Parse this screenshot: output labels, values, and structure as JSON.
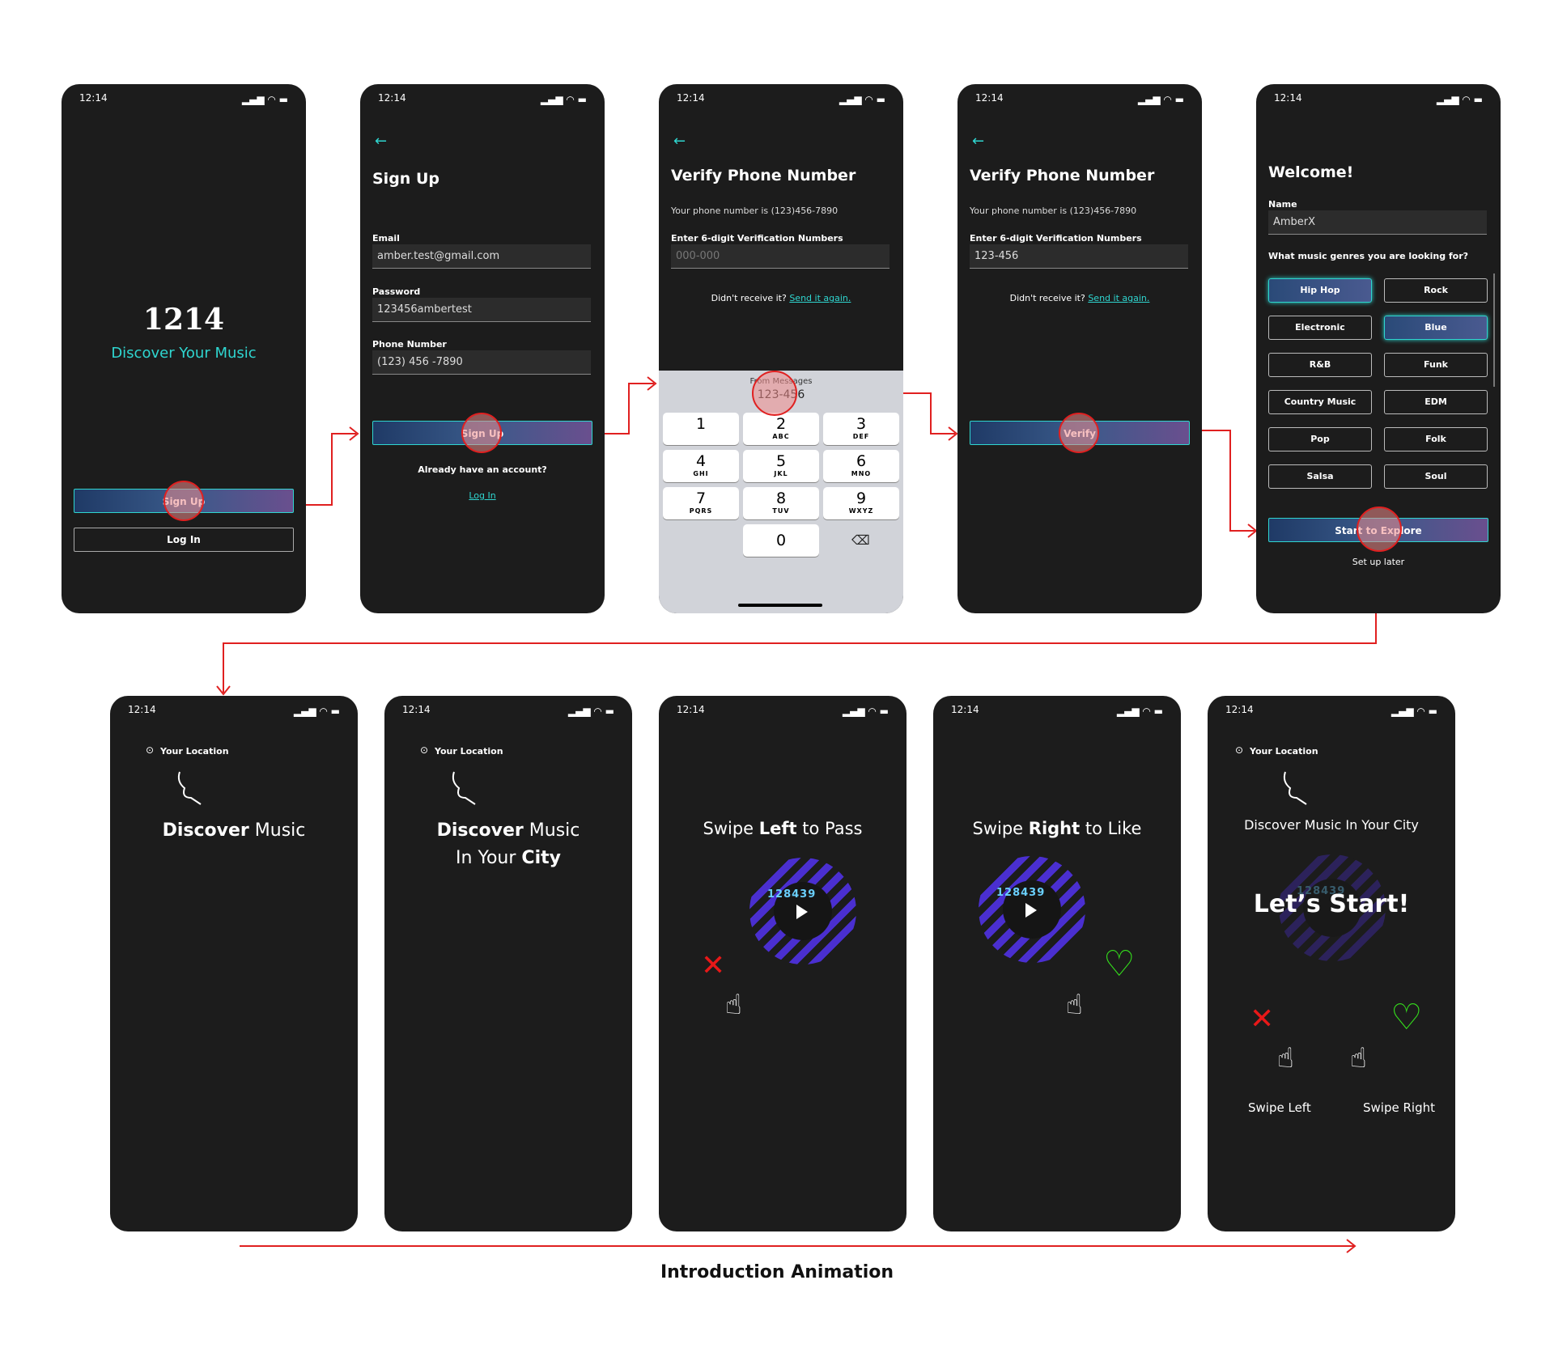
{
  "status_time": "12:14",
  "screen1": {
    "logo": "1214",
    "tagline": "Discover Your Music",
    "signup_label": "Sign Up",
    "login_label": "Log In"
  },
  "screen2": {
    "title": "Sign Up",
    "email_label": "Email",
    "email_value": "amber.test@gmail.com",
    "password_label": "Password",
    "password_value": "123456ambertest",
    "phone_label": "Phone Number",
    "phone_value": "(123) 456 -7890",
    "signup_label": "Sign Up",
    "have_account": "Already have an account?",
    "login_link": "Log In"
  },
  "screen3": {
    "title": "Verify Phone Number",
    "phone_text": "Your phone number is (123)456-7890",
    "code_label": "Enter 6-digit Verification Numbers",
    "code_placeholder": "000-000",
    "didnt_receive": "Didn't receive it?",
    "send_again": "Send it again.",
    "suggest_source": "From Messages",
    "suggest_code": "123-456",
    "keys": [
      {
        "d": "1",
        "l": ""
      },
      {
        "d": "2",
        "l": "ABC"
      },
      {
        "d": "3",
        "l": "DEF"
      },
      {
        "d": "4",
        "l": "GHI"
      },
      {
        "d": "5",
        "l": "JKL"
      },
      {
        "d": "6",
        "l": "MNO"
      },
      {
        "d": "7",
        "l": "PQRS"
      },
      {
        "d": "8",
        "l": "TUV"
      },
      {
        "d": "9",
        "l": "WXYZ"
      },
      {
        "d": "0",
        "l": ""
      }
    ]
  },
  "screen4": {
    "title": "Verify Phone Number",
    "phone_text": "Your phone number is (123)456-7890",
    "code_label": "Enter 6-digit Verification Numbers",
    "code_value": "123-456",
    "didnt_receive": "Didn't receive it?",
    "send_again": "Send it again.",
    "verify_label": "Verify"
  },
  "screen5": {
    "title": "Welcome!",
    "name_label": "Name",
    "name_value": "AmberX",
    "genres_question": "What music genres you are looking for?",
    "genres": [
      {
        "label": "Hip Hop",
        "selected": true
      },
      {
        "label": "Rock",
        "selected": false
      },
      {
        "label": "Electronic",
        "selected": false
      },
      {
        "label": "Blue",
        "selected": true
      },
      {
        "label": "R&B",
        "selected": false
      },
      {
        "label": "Funk",
        "selected": false
      },
      {
        "label": "Country Music",
        "selected": false
      },
      {
        "label": "EDM",
        "selected": false
      },
      {
        "label": "Pop",
        "selected": false
      },
      {
        "label": "Folk",
        "selected": false
      },
      {
        "label": "Salsa",
        "selected": false
      },
      {
        "label": "Soul",
        "selected": false
      }
    ],
    "start_label": "Start to Explore",
    "later_label": "Set up later"
  },
  "screen6": {
    "location": "Your Location",
    "bold": "Discover",
    "rest": " Music"
  },
  "screen7": {
    "location": "Your Location",
    "line1_bold": "Discover",
    "line1_rest": " Music",
    "line2_pre": "In Your ",
    "line2_bold": "City"
  },
  "screen8": {
    "pre": "Swipe ",
    "bold": "Left",
    "post": " to Pass",
    "disc_number": "128439"
  },
  "screen9": {
    "pre": "Swipe ",
    "bold": "Right",
    "post": " to Like",
    "disc_number": "128439"
  },
  "screen10": {
    "location": "Your Location",
    "subtitle": "Discover Music In Your City",
    "headline": "Let’s Start!",
    "disc_number": "128439",
    "swipe_left": "Swipe Left",
    "swipe_right": "Swipe Right"
  },
  "caption": "Introduction Animation",
  "colors": {
    "accent": "#2fd6d0",
    "arrow": "#e02020",
    "phone_bg": "#1c1c1c",
    "like": "#35e01c",
    "pass": "#e81818"
  }
}
